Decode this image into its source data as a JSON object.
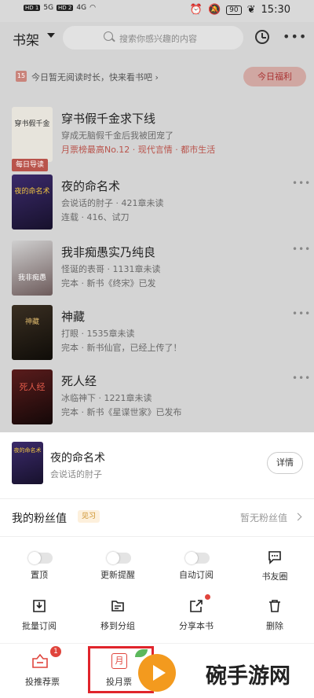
{
  "status_bar": {
    "left_indicators": [
      "HD 1",
      "5G",
      "HD 2",
      "4G"
    ],
    "time": "15:30",
    "battery": "90"
  },
  "header": {
    "title": "书架",
    "search_placeholder": "搜索你感兴趣的内容"
  },
  "banner": {
    "calendar_day": "15",
    "text": "今日暂无阅读时长，快来看书吧 ›",
    "button": "今日福利"
  },
  "books": [
    {
      "cover_text": "穿书假千金",
      "title": "穿书假千金求下线",
      "line1": "穿成无脑假千金后我被团宠了",
      "line2": "月票榜最高No.12 · 现代言情 · 都市生活",
      "tag": "每日导读"
    },
    {
      "cover_text": "夜的命名术",
      "title": "夜的命名术",
      "line1": "会说话的肘子 · 421章未读",
      "line2": "连载 · 416、试刀"
    },
    {
      "cover_text": "我非痴愚",
      "title": "我非痴愚实乃纯良",
      "line1": "怪诞的表哥 · 1131章未读",
      "line2": "完本 · 新书《终宋》已发"
    },
    {
      "cover_text": "神藏",
      "title": "神藏",
      "line1": "打眼 · 1535章未读",
      "line2": "完本 · 新书仙官，已经上传了！"
    },
    {
      "cover_text": "死人经",
      "title": "死人经",
      "line1": "冰临神下 · 1221章未读",
      "line2": "完本 · 新书《星谍世家》已发布"
    }
  ],
  "sheet": {
    "cover_text": "夜的命名术",
    "title": "夜的命名术",
    "author": "会说话的肘子",
    "detail_button": "详情",
    "fan_label": "我的粉丝值",
    "fan_badge": "见习",
    "fan_value": "暂无粉丝值",
    "row1": [
      {
        "label": "置顶",
        "type": "toggle"
      },
      {
        "label": "更新提醒",
        "type": "toggle"
      },
      {
        "label": "自动订阅",
        "type": "toggle"
      },
      {
        "label": "书友圈",
        "type": "icon",
        "icon": "chat-bubble-icon"
      }
    ],
    "row2": [
      {
        "label": "批量订阅",
        "icon": "download-icon"
      },
      {
        "label": "移到分组",
        "icon": "folder-icon"
      },
      {
        "label": "分享本书",
        "icon": "share-icon"
      },
      {
        "label": "删除",
        "icon": "trash-icon"
      }
    ],
    "recommend_ticket": "投推荐票",
    "recommend_badge": "1",
    "monthly_ticket": "投月票",
    "monthly_glyph": "月"
  },
  "watermark": "碗手游网",
  "colors": {
    "accent_red": "#e0443c",
    "overlay_gray": "#d4d4d4",
    "highlight_red": "#e0242b"
  }
}
